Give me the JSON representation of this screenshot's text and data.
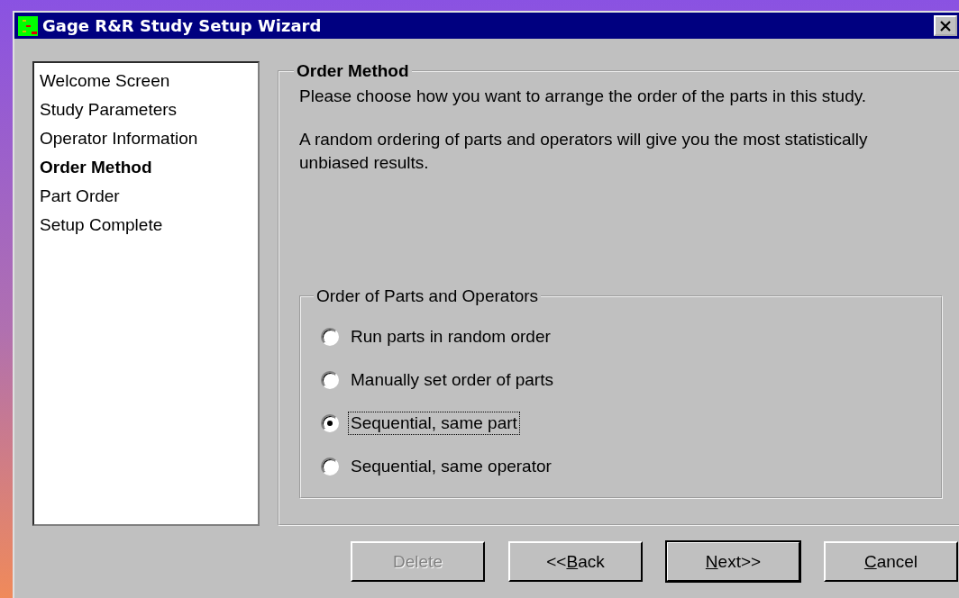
{
  "window": {
    "title": "Gage R&R Study Setup Wizard"
  },
  "steps": [
    {
      "label": "Welcome Screen",
      "selected": false
    },
    {
      "label": "Study Parameters",
      "selected": false
    },
    {
      "label": "Operator Information",
      "selected": false
    },
    {
      "label": "Order Method",
      "selected": true
    },
    {
      "label": "Part Order",
      "selected": false
    },
    {
      "label": "Setup Complete",
      "selected": false
    }
  ],
  "panel": {
    "title": "Order Method",
    "paragraphs": [
      "Please choose how you want to arrange the order of the parts in this study.",
      "A random ordering of parts and operators will give you the most statistically unbiased results."
    ]
  },
  "group": {
    "title": "Order of Parts and Operators",
    "options": [
      {
        "label": "Run parts in random order",
        "selected": false,
        "focused": false
      },
      {
        "label": "Manually set order of parts",
        "selected": false,
        "focused": false
      },
      {
        "label": "Sequential, same part",
        "selected": true,
        "focused": true
      },
      {
        "label": "Sequential, same operator",
        "selected": false,
        "focused": false
      }
    ]
  },
  "buttons": [
    {
      "before": "Delete",
      "disabled": true,
      "default": false
    },
    {
      "before": "<<",
      "key": "B",
      "after": "ack",
      "disabled": false,
      "default": false
    },
    {
      "key": "N",
      "after": "ext>>",
      "disabled": false,
      "default": true
    },
    {
      "key": "C",
      "after": "ancel",
      "disabled": false,
      "default": false
    }
  ]
}
